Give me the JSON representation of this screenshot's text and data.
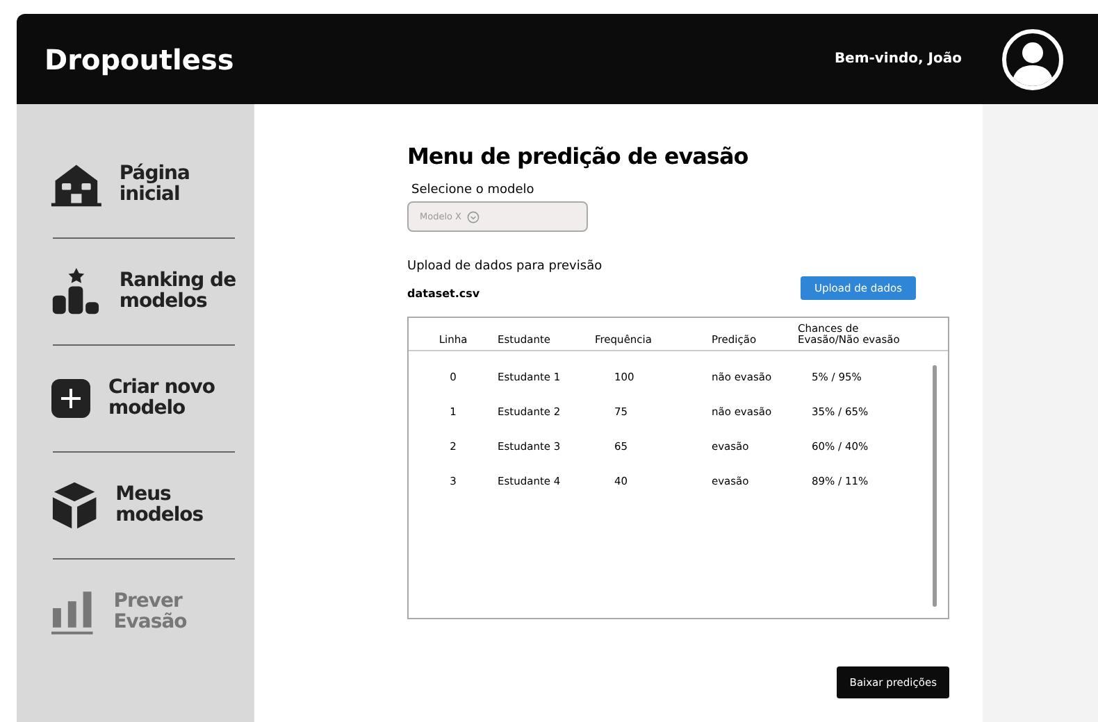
{
  "header": {
    "brand": "Dropoutless",
    "greeting": "Bem-vindo, João"
  },
  "sidebar": {
    "items": [
      {
        "kind": "home",
        "label": "Página inicial",
        "selected": false
      },
      {
        "kind": "ranking",
        "label": "Ranking de modelos",
        "selected": false
      },
      {
        "kind": "create",
        "label": "Criar novo modelo",
        "selected": false
      },
      {
        "kind": "models",
        "label": "Meus modelos",
        "selected": false
      },
      {
        "kind": "predict",
        "label": "Prever Evasão",
        "selected": true
      }
    ]
  },
  "main": {
    "title": "Menu de predição de evasão",
    "model_label": "Selecione o modelo",
    "model_select": {
      "value": "Modelo X"
    },
    "upload_label": "Upload de dados para previsão",
    "file_name": "dataset.csv",
    "upload_button": "Upload de dados",
    "table": {
      "columns": [
        "Linha",
        "Estudante",
        "Frequência",
        "Predição",
        "Chances de Evasão/Não evasão"
      ],
      "rows": [
        [
          "0",
          "Estudante 1",
          "100",
          "não evasão",
          "5% / 95%"
        ],
        [
          "1",
          "Estudante 2",
          "75",
          "não evasão",
          "35% / 65%"
        ],
        [
          "2",
          "Estudante 3",
          "65",
          "evasão",
          "60% / 40%"
        ],
        [
          "3",
          "Estudante 4",
          "40",
          "evasão",
          "89% / 11%"
        ]
      ]
    },
    "download_button": "Baixar predições"
  }
}
